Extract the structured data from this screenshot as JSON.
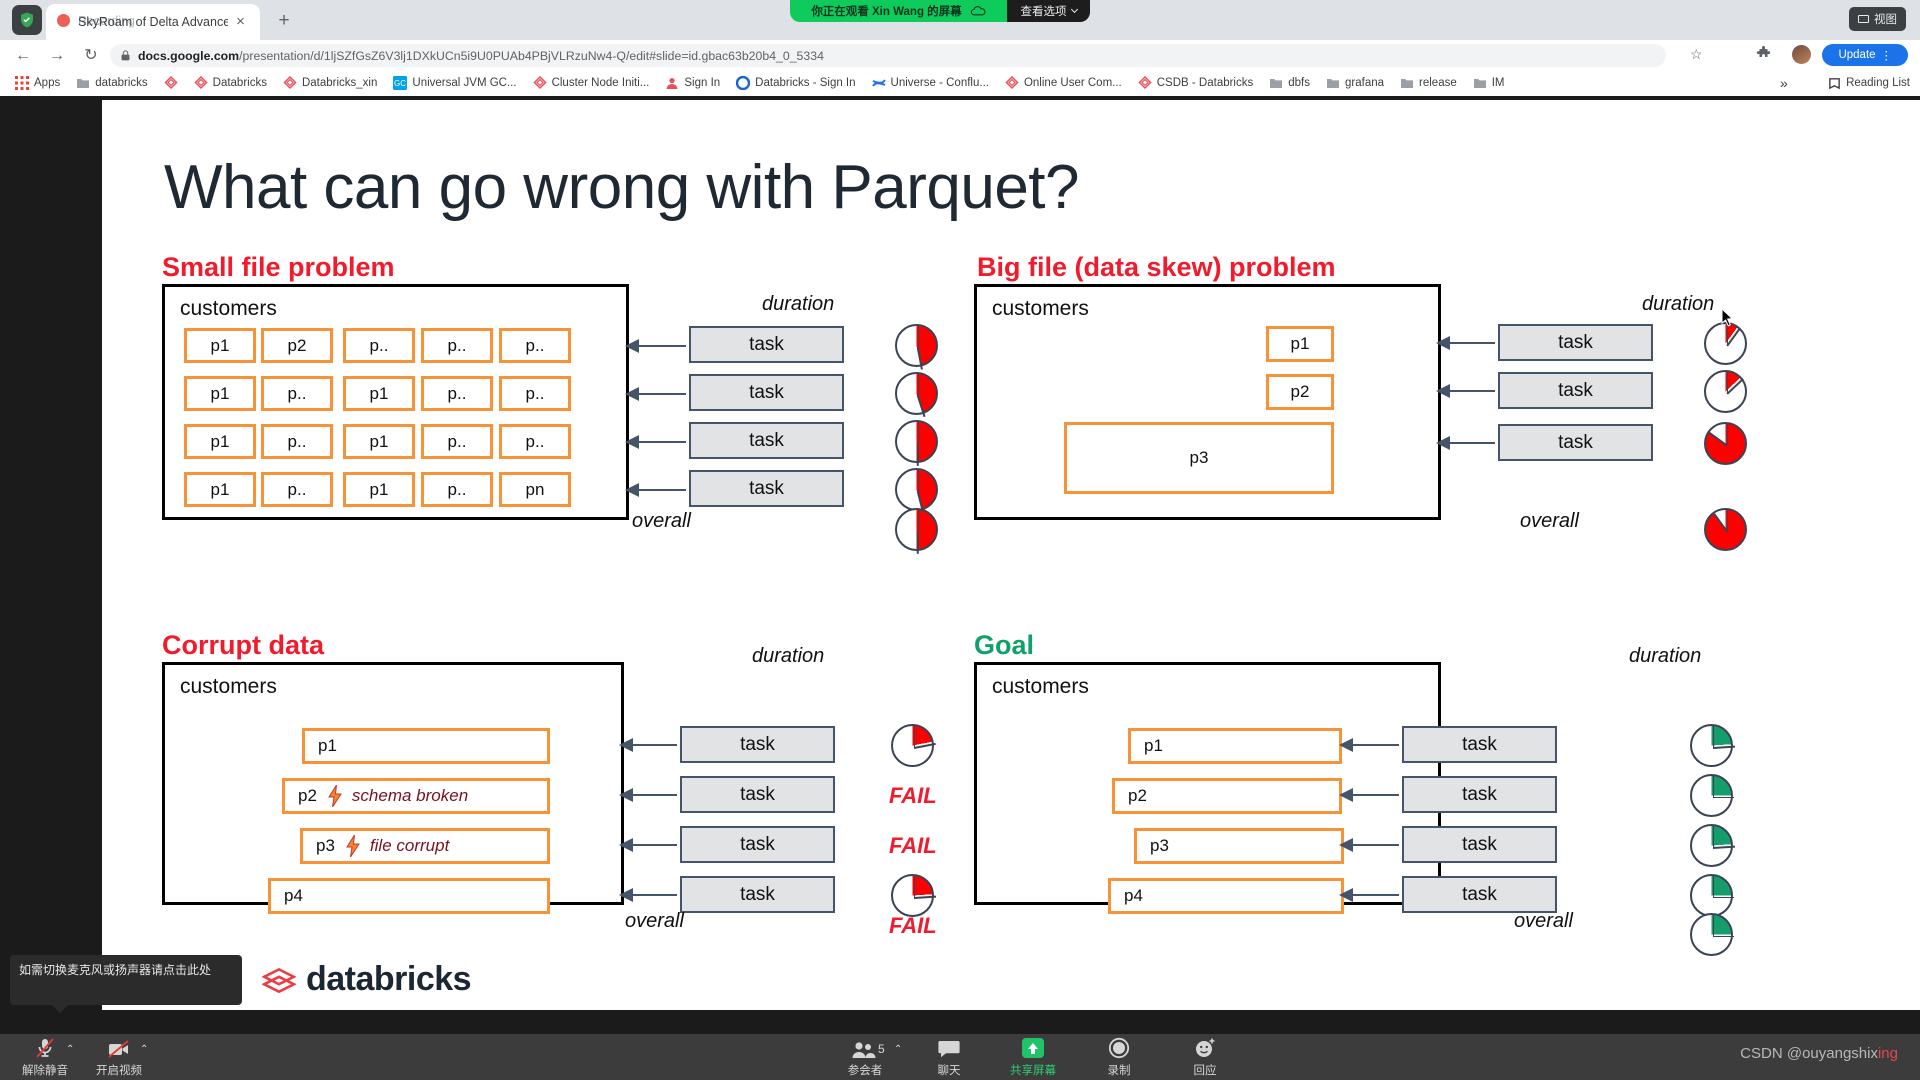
{
  "browser": {
    "tab": {
      "title": "SkyRoam of Delta Advanced - G",
      "overlay_title": "Recording",
      "close_label": "×",
      "newtab_label": "+"
    },
    "omnibox": {
      "url_bold": "docs.google.com",
      "url_rest": "/presentation/d/1ljSZfGsZ6V3lj1DXkUCn5i9U0PUAb4PBjVLRzuNw4-Q/edit#slide=id.gbac63b20b4_0_5334"
    },
    "update_label": "Update",
    "window_button_label": "视图",
    "bookmarks": [
      {
        "label": "Apps",
        "icon": "apps-grid-icon"
      },
      {
        "label": "databricks",
        "icon": "folder-icon"
      },
      {
        "label": "",
        "icon": "bookmark-page-icon"
      },
      {
        "label": "Databricks",
        "icon": "bookmark-page-icon"
      },
      {
        "label": "Databricks_xin",
        "icon": "bookmark-page-icon"
      },
      {
        "label": "Universal JVM GC...",
        "icon": "gc-icon"
      },
      {
        "label": "Cluster Node Initi...",
        "icon": "bookmark-page-icon"
      },
      {
        "label": "Sign In",
        "icon": "signin-icon"
      },
      {
        "label": "Databricks - Sign In",
        "icon": "circle-icon"
      },
      {
        "label": "Universe - Conflu...",
        "icon": "confluence-icon"
      },
      {
        "label": "Online User Com...",
        "icon": "bookmark-page-icon"
      },
      {
        "label": "CSDB - Databricks",
        "icon": "bookmark-page-icon"
      },
      {
        "label": "dbfs",
        "icon": "folder-icon"
      },
      {
        "label": "grafana",
        "icon": "folder-icon"
      },
      {
        "label": "release",
        "icon": "folder-icon"
      },
      {
        "label": "IM",
        "icon": "folder-icon"
      }
    ],
    "bookmarks_overflow": "»",
    "reading_list": "Reading List"
  },
  "share_banner": {
    "message": "你正在观看 Xin Wang 的屏幕",
    "options_label": "查看选项"
  },
  "slide": {
    "title": "What can go wrong with Parquet?",
    "brand": "databricks",
    "quadrants": [
      {
        "id": "small-file-problem",
        "heading": "Small file problem",
        "heading_color": "#f01c2d",
        "panel_label": "customers",
        "duration_label": "duration",
        "overall_label": "overall",
        "grid": [
          [
            "p1",
            "p2",
            "p..",
            "p..",
            "p.."
          ],
          [
            "p1",
            "p..",
            "p1",
            "p..",
            "p.."
          ],
          [
            "p1",
            "p..",
            "p1",
            "p..",
            "p.."
          ],
          [
            "p1",
            "p..",
            "p1",
            "p..",
            "pn"
          ]
        ],
        "tasks": [
          "task",
          "task",
          "task",
          "task"
        ],
        "pies": [
          47,
          45,
          50,
          46
        ],
        "overall_pie": 50,
        "pie_color": "#ff0000"
      },
      {
        "id": "big-file-problem",
        "heading": "Big file (data skew) problem",
        "heading_color": "#f01c2d",
        "panel_label": "customers",
        "duration_label": "duration",
        "overall_label": "overall",
        "parts": [
          "p1",
          "p2",
          "p3"
        ],
        "tasks": [
          "task",
          "task",
          "task"
        ],
        "pies": [
          10,
          13,
          85
        ],
        "overall_pie": 90,
        "pie_color": "#ff0000"
      },
      {
        "id": "corrupt-data",
        "heading": "Corrupt data",
        "heading_color": "#f01c2d",
        "panel_label": "customers",
        "duration_label": "duration",
        "overall_label": "overall",
        "parts": [
          {
            "name": "p1",
            "note": ""
          },
          {
            "name": "p2",
            "note": "schema broken"
          },
          {
            "name": "p3",
            "note": "file corrupt"
          },
          {
            "name": "p4",
            "note": ""
          }
        ],
        "tasks": [
          "task",
          "task",
          "task",
          "task"
        ],
        "results": [
          "pie:22",
          "FAIL",
          "FAIL",
          "pie:24"
        ],
        "overall_result": "FAIL",
        "fail_label": "FAIL",
        "pie_color": "#ff0000"
      },
      {
        "id": "goal",
        "heading": "Goal",
        "heading_color": "#11a069",
        "panel_label": "customers",
        "duration_label": "duration",
        "overall_label": "overall",
        "parts": [
          "p1",
          "p2",
          "p3",
          "p4"
        ],
        "tasks": [
          "task",
          "task",
          "task",
          "task"
        ],
        "pies": [
          24,
          25,
          24,
          25
        ],
        "overall_pie": 25,
        "pie_color": "#159e6b"
      }
    ]
  },
  "zoom_toolbar": {
    "items": [
      {
        "label": "解除静音",
        "icon": "mic-muted-icon",
        "active": false,
        "caret": true
      },
      {
        "label": "开启视频",
        "icon": "camera-off-icon",
        "active": false,
        "caret": true
      },
      {
        "label": "参会者",
        "icon": "participants-icon",
        "active": false,
        "caret": true,
        "badge": "5"
      },
      {
        "label": "聊天",
        "icon": "chat-icon",
        "active": false,
        "caret": false
      },
      {
        "label": "共享屏幕",
        "icon": "share-screen-icon",
        "active": true,
        "caret": false
      },
      {
        "label": "录制",
        "icon": "record-icon",
        "active": false,
        "caret": false
      },
      {
        "label": "回应",
        "icon": "reactions-icon",
        "active": false,
        "caret": false
      }
    ]
  },
  "tooltip": {
    "text": "如需切换麦克风或扬声器请点击此处"
  },
  "watermark": {
    "prefix": "CSDN @ouyangshix",
    "suffix": "ing"
  }
}
